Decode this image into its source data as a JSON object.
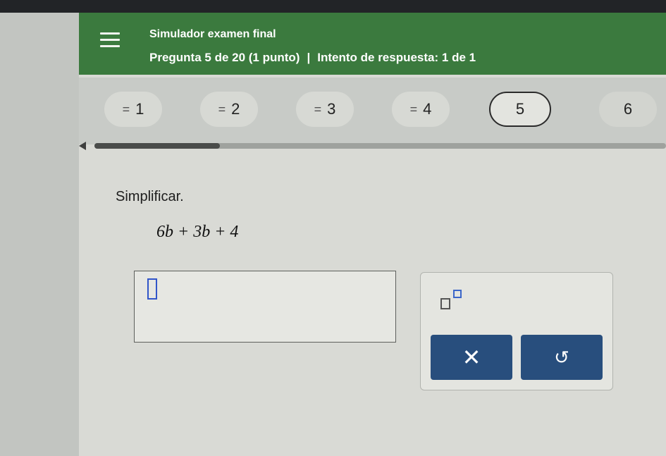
{
  "header": {
    "title": "Simulador examen final",
    "question_info": "Pregunta 5 de 20 (1 punto)",
    "separator": "|",
    "attempt_info": "Intento de respuesta: 1 de 1"
  },
  "questions": [
    {
      "label": "1",
      "answered": true
    },
    {
      "label": "2",
      "answered": true
    },
    {
      "label": "3",
      "answered": true
    },
    {
      "label": "4",
      "answered": true
    },
    {
      "label": "5",
      "current": true
    },
    {
      "label": "6",
      "answered": false
    }
  ],
  "check_glyph": "=",
  "progress": {
    "fraction": 0.22
  },
  "problem": {
    "prompt": "Simplificar.",
    "expression": "6b + 3b + 4"
  },
  "answer": {
    "value": ""
  },
  "keypad": {
    "clear_symbol": "✕",
    "undo_symbol": "↺",
    "button_color": "#284e7d"
  },
  "colors": {
    "header": "#3b7a3e"
  }
}
